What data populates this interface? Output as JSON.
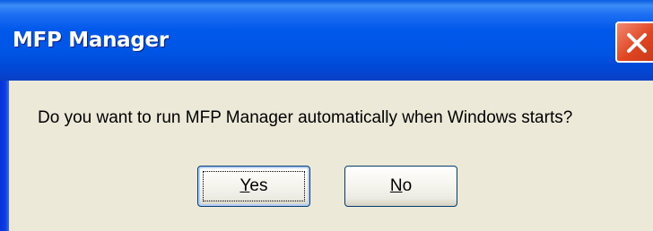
{
  "window": {
    "title": "MFP Manager"
  },
  "dialog": {
    "message": "Do you want to run MFP Manager automatically when Windows starts?",
    "buttons": {
      "yes": {
        "accel": "Y",
        "rest": "es"
      },
      "no": {
        "accel": "N",
        "rest": "o"
      }
    }
  },
  "icons": {
    "close": "close-icon"
  },
  "colors": {
    "titlebar": "#0058ea",
    "dialog_bg": "#ece9d8",
    "close_button": "#e04520"
  }
}
